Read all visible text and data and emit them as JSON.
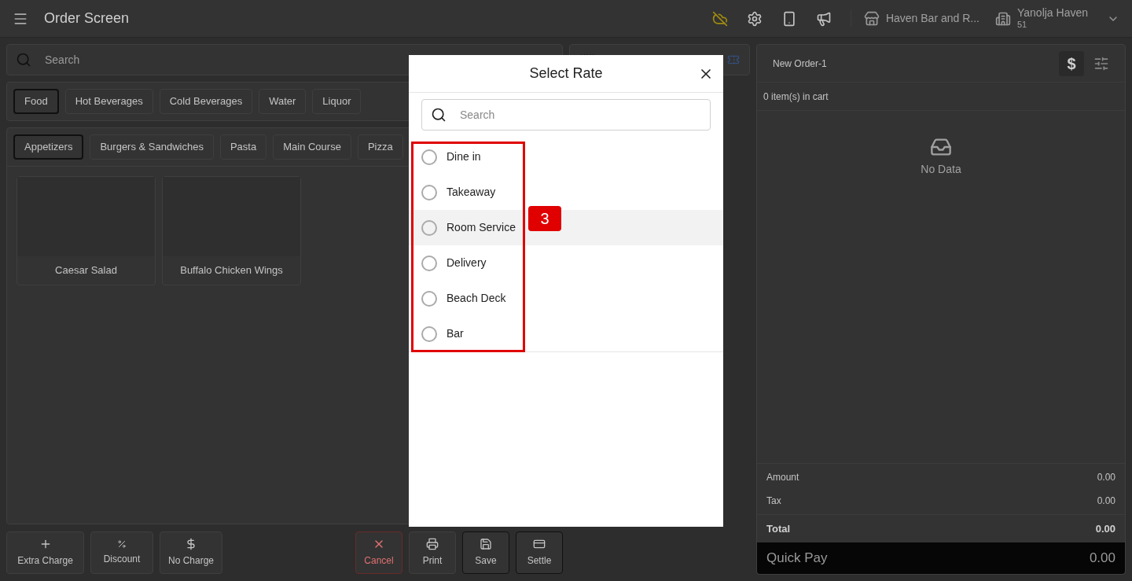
{
  "header": {
    "title": "Order Screen",
    "outlet": "Haven Bar and R...",
    "property": "Yanolja Haven",
    "property_code": "51"
  },
  "search": {
    "placeholder": "Search"
  },
  "categories": [
    {
      "label": "Food",
      "selected": true
    },
    {
      "label": "Hot Beverages",
      "selected": false
    },
    {
      "label": "Cold Beverages",
      "selected": false
    },
    {
      "label": "Water",
      "selected": false
    },
    {
      "label": "Liquor",
      "selected": false
    }
  ],
  "subcategories": [
    {
      "label": "Appetizers",
      "selected": true
    },
    {
      "label": "Burgers & Sandwiches",
      "selected": false
    },
    {
      "label": "Pasta",
      "selected": false
    },
    {
      "label": "Main Course",
      "selected": false
    },
    {
      "label": "Pizza",
      "selected": false
    }
  ],
  "items": [
    {
      "name": "Caesar Salad"
    },
    {
      "name": "Buffalo Chicken Wings"
    }
  ],
  "bottom_actions": [
    {
      "label": "Extra Charge",
      "kind": "extra"
    },
    {
      "label": "Discount",
      "kind": "discount"
    },
    {
      "label": "No Charge",
      "kind": "nocharge"
    }
  ],
  "order_actions": [
    {
      "label": "Cancel",
      "kind": "cancel"
    },
    {
      "label": "Print",
      "kind": "print"
    },
    {
      "label": "Save",
      "kind": "save"
    },
    {
      "label": "Settle",
      "kind": "settle"
    }
  ],
  "cart": {
    "order_name": "New Order-1",
    "currency": "$",
    "count": "0 item(s) in cart",
    "empty": "No Data",
    "lines": [
      {
        "label": "Amount",
        "value": "0.00"
      },
      {
        "label": "Tax",
        "value": "0.00"
      }
    ],
    "total": {
      "label": "Total",
      "value": "0.00"
    },
    "quick_pay": {
      "label": "Quick Pay",
      "value": "0.00"
    }
  },
  "dialog": {
    "title": "Select Rate",
    "search_placeholder": "Search",
    "options": [
      {
        "label": "Dine in",
        "selected": false,
        "hovered": false
      },
      {
        "label": "Takeaway",
        "selected": false,
        "hovered": false
      },
      {
        "label": "Room Service",
        "selected": false,
        "hovered": true
      },
      {
        "label": "Delivery",
        "selected": false,
        "hovered": false
      },
      {
        "label": "Beach Deck",
        "selected": false,
        "hovered": false
      },
      {
        "label": "Bar",
        "selected": false,
        "hovered": false
      }
    ]
  },
  "annotation": {
    "label": "3"
  }
}
